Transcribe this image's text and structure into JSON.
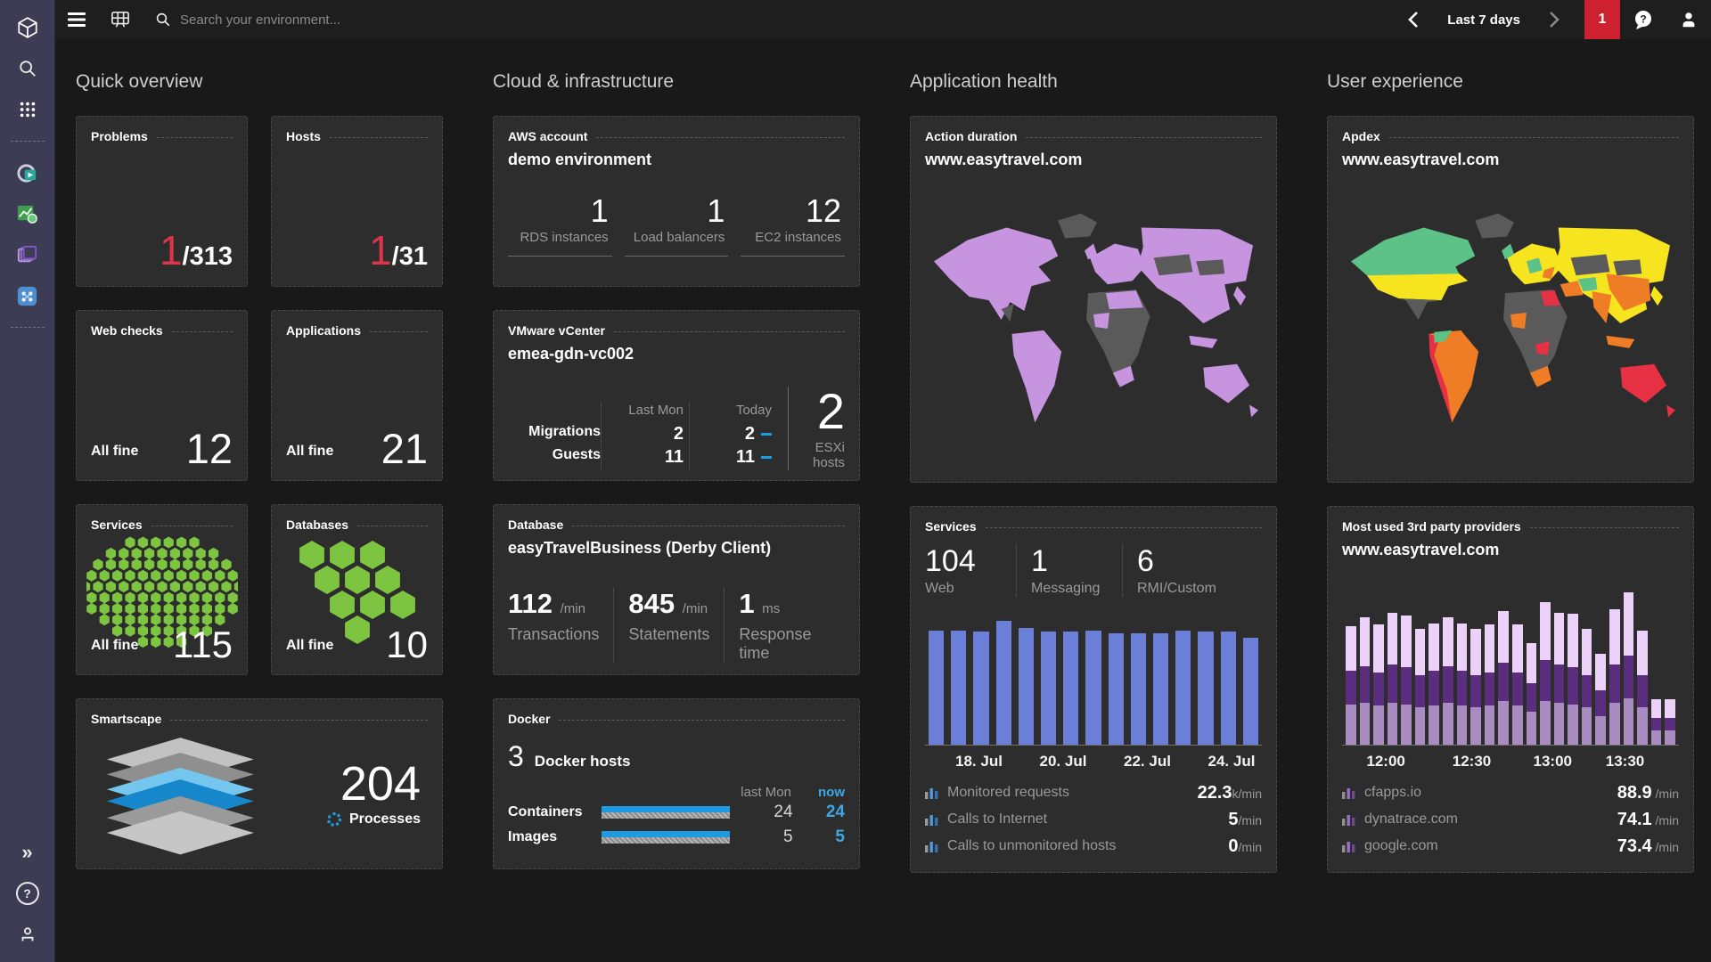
{
  "topbar": {
    "search_placeholder": "Search your environment...",
    "timeframe": "Last 7 days",
    "badge": "1"
  },
  "sidebar": {
    "expand_glyph": "»",
    "help_glyph": "?"
  },
  "palette": {
    "red": "#e0344a",
    "blue": "#1e9be0",
    "hex_green": "#7dc540",
    "bar_blue": "#6b7ed8",
    "purple_bottom": "#a98cc0",
    "purple_mid": "#5a2d7e",
    "purple_top": "#ecd2f8"
  },
  "maps": {
    "land_purple": "#c795df",
    "land_gray": "#5a5a5a",
    "apdex_green": "#5cc287",
    "apdex_yellow": "#f6e41f",
    "apdex_orange": "#ef7d26",
    "apdex_red": "#e63145",
    "apdex_gray": "#5a5a5a"
  },
  "quick_overview": {
    "title": "Quick overview",
    "problems": {
      "label": "Problems",
      "value": "1",
      "total": "/313"
    },
    "hosts": {
      "label": "Hosts",
      "value": "1",
      "total": "/31"
    },
    "web_checks": {
      "label": "Web checks",
      "status": "All fine",
      "value": "12"
    },
    "applications": {
      "label": "Applications",
      "status": "All fine",
      "value": "21"
    },
    "services": {
      "label": "Services",
      "status": "All fine",
      "value": "115"
    },
    "databases": {
      "label": "Databases",
      "status": "All fine",
      "value": "10"
    },
    "smartscape": {
      "label": "Smartscape",
      "value": "204",
      "caption": "Processes"
    }
  },
  "cloud": {
    "title": "Cloud & infrastructure",
    "aws": {
      "label": "AWS account",
      "name": "demo environment",
      "stats": [
        {
          "value": "1",
          "label": "RDS instances"
        },
        {
          "value": "1",
          "label": "Load balancers"
        },
        {
          "value": "12",
          "label": "EC2 instances"
        }
      ]
    },
    "vmware": {
      "label": "VMware vCenter",
      "name": "emea-gdn-vc002",
      "col1": "Last Mon",
      "col2": "Today",
      "rows": [
        {
          "label": "Migrations",
          "last": "2",
          "today": "2"
        },
        {
          "label": "Guests",
          "last": "11",
          "today": "11"
        }
      ],
      "esxi_value": "2",
      "esxi_label": "ESXi hosts"
    },
    "database": {
      "label": "Database",
      "name": "easyTravelBusiness (Derby Client)",
      "stats": [
        {
          "value": "112",
          "unit": "/min",
          "label": "Transactions"
        },
        {
          "value": "845",
          "unit": "/min",
          "label": "Statements"
        },
        {
          "value": "1",
          "unit": "ms",
          "label": "Response time"
        }
      ]
    },
    "docker": {
      "label": "Docker",
      "hosts_value": "3",
      "hosts_label": "Docker hosts",
      "col1": "last Mon",
      "col2": "now",
      "rows": [
        {
          "label": "Containers",
          "last": "24",
          "now": "24"
        },
        {
          "label": "Images",
          "last": "5",
          "now": "5"
        }
      ]
    }
  },
  "app_health": {
    "title": "Application health",
    "action_duration": {
      "label": "Action duration",
      "name": "www.easytravel.com"
    },
    "services": {
      "label": "Services",
      "stats": [
        {
          "value": "104",
          "label": "Web"
        },
        {
          "value": "1",
          "label": "Messaging"
        },
        {
          "value": "6",
          "label": "RMI/Custom"
        }
      ],
      "list": [
        {
          "label": "Monitored requests",
          "value": "22.3",
          "unit": "k/min"
        },
        {
          "label": "Calls to Internet",
          "value": "5",
          "unit": "/min"
        },
        {
          "label": "Calls to unmonitored hosts",
          "value": "0",
          "unit": "/min"
        }
      ]
    }
  },
  "user_experience": {
    "title": "User experience",
    "apdex": {
      "label": "Apdex",
      "name": "www.easytravel.com"
    },
    "providers": {
      "label": "Most used 3rd party providers",
      "name": "www.easytravel.com",
      "list": [
        {
          "label": "cfapps.io",
          "value": "88.9",
          "unit": "/min"
        },
        {
          "label": "dynatrace.com",
          "value": "74.1",
          "unit": "/min"
        },
        {
          "label": "google.com",
          "value": "73.4",
          "unit": "/min"
        }
      ]
    }
  },
  "chart_data": [
    {
      "id": "services-requests",
      "type": "bar",
      "title": "Monitored requests over last 7 days",
      "x_tick_labels": [
        "18. Jul",
        "20. Jul",
        "22. Jul",
        "24. Jul"
      ],
      "tick_positions": [
        0.16,
        0.41,
        0.66,
        0.91
      ],
      "values": [
        88,
        88,
        87,
        95,
        90,
        87,
        87,
        88,
        86,
        86,
        86,
        88,
        87,
        87,
        82
      ],
      "ylim": [
        0,
        100
      ],
      "color": "#6b7ed8",
      "grid": false,
      "legend": "none"
    },
    {
      "id": "third-party-providers",
      "type": "stacked-bar",
      "title": "3rd party provider requests",
      "x_tick_labels": [
        "12:00",
        "12:30",
        "13:00",
        "13:30"
      ],
      "tick_positions": [
        0.13,
        0.385,
        0.625,
        0.84
      ],
      "series": [
        {
          "name": "provider-bottom",
          "color": "#a98cc0",
          "values": [
            27,
            28,
            26,
            28,
            27,
            25,
            26,
            28,
            26,
            25,
            26,
            29,
            26,
            22,
            29,
            28,
            27,
            25,
            19,
            28,
            31,
            25,
            10,
            10
          ]
        },
        {
          "name": "provider-middle",
          "color": "#5a2d7e",
          "values": [
            22,
            24,
            22,
            25,
            24,
            21,
            23,
            24,
            23,
            21,
            22,
            25,
            22,
            19,
            27,
            25,
            24,
            21,
            17,
            25,
            28,
            21,
            8,
            8
          ]
        },
        {
          "name": "provider-top",
          "color": "#ecd2f8",
          "values": [
            29,
            32,
            31,
            34,
            34,
            30,
            31,
            32,
            31,
            30,
            31,
            34,
            31,
            26,
            38,
            34,
            35,
            30,
            24,
            36,
            41,
            29,
            12,
            12
          ]
        }
      ],
      "ylim": [
        0,
        110
      ],
      "grid": false,
      "legend": "none"
    }
  ]
}
